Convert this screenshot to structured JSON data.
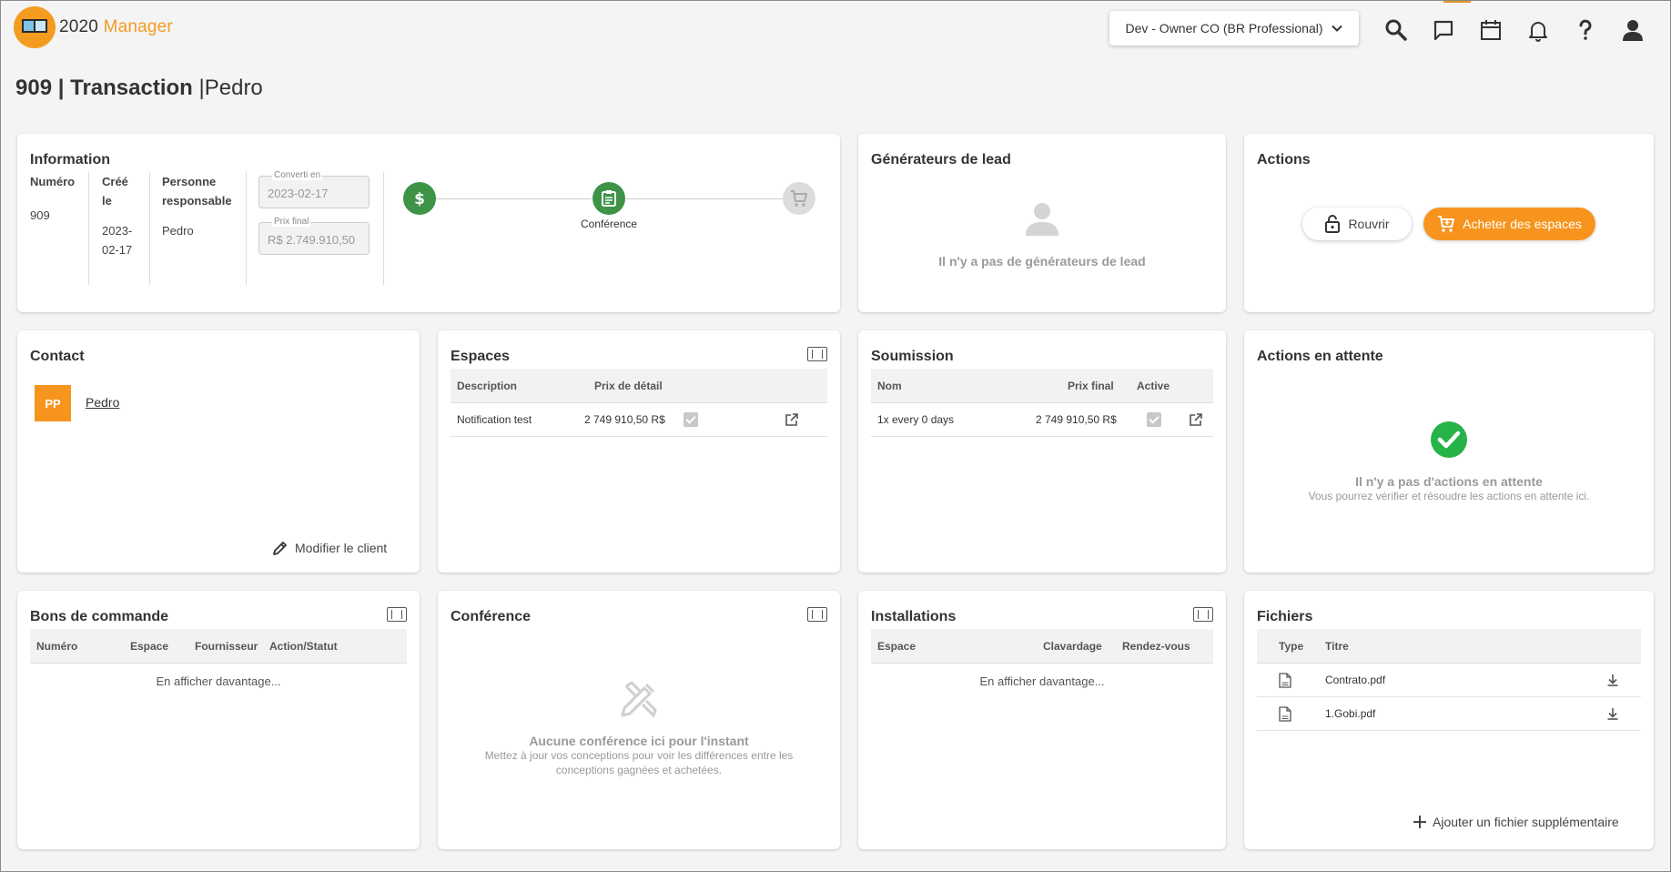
{
  "header": {
    "logo_text_a": "2020",
    "logo_text_b": "Manager",
    "org_select": "Dev - Owner CO (BR Professional)"
  },
  "page": {
    "title_number": "909",
    "title_sep": "|",
    "title_label": "Transaction",
    "title_person": "Pedro"
  },
  "information": {
    "title": "Information",
    "numero_label": "Numéro",
    "numero_value": "909",
    "cree_label_1": "Créé",
    "cree_label_2": "le",
    "cree_value_1": "2023-",
    "cree_value_2": "02-17",
    "resp_label_1": "Personne",
    "resp_label_2": "responsable",
    "resp_value": "Pedro",
    "converti_label": "Converti en",
    "converti_value": "2023-02-17",
    "prix_label": "Prix final",
    "prix_value": "R$ 2.749.910,50",
    "step_active_label": "Conférence"
  },
  "lead": {
    "title": "Générateurs de lead",
    "empty": "Il n'y a pas de générateurs de lead"
  },
  "actions": {
    "title": "Actions",
    "reopen": "Rouvrir",
    "buy": "Acheter des espaces"
  },
  "contact": {
    "title": "Contact",
    "initials": "PP",
    "name": "Pedro",
    "edit": "Modifier le client"
  },
  "espaces": {
    "title": "Espaces",
    "col_desc": "Description",
    "col_price": "Prix de détail",
    "rows": [
      {
        "desc": "Notification test",
        "price": "2 749 910,50 R$"
      }
    ]
  },
  "soumission": {
    "title": "Soumission",
    "col_nom": "Nom",
    "col_price": "Prix final",
    "col_active": "Active",
    "rows": [
      {
        "nom": "1x every 0 days",
        "price": "2 749 910,50 R$"
      }
    ]
  },
  "pending": {
    "title": "Actions en attente",
    "empty_title": "Il n'y a pas d'actions en attente",
    "empty_sub": "Vous pourrez vérifier et résoudre les actions en attente ici."
  },
  "bons": {
    "title": "Bons de commande",
    "col_numero": "Numéro",
    "col_espace": "Espace",
    "col_fournisseur": "Fournisseur",
    "col_action": "Action/Statut",
    "more": "En afficher davantage..."
  },
  "conference": {
    "title": "Conférence",
    "empty_title": "Aucune conférence ici pour l'instant",
    "empty_sub_1": "Mettez à jour vos conceptions pour voir les différences entre les",
    "empty_sub_2": "conceptions gagnées et achetées."
  },
  "installations": {
    "title": "Installations",
    "col_espace": "Espace",
    "col_clavardage": "Clavardage",
    "col_rdv": "Rendez-vous",
    "more": "En afficher davantage..."
  },
  "fichiers": {
    "title": "Fichiers",
    "col_type": "Type",
    "col_titre": "Titre",
    "rows": [
      {
        "titre": "Contrato.pdf"
      },
      {
        "titre": "1.Gobi.pdf"
      }
    ],
    "add": "Ajouter un fichier supplémentaire"
  },
  "colors": {
    "accent": "#f7941d",
    "success": "#3d9447",
    "check": "#27b34a"
  }
}
